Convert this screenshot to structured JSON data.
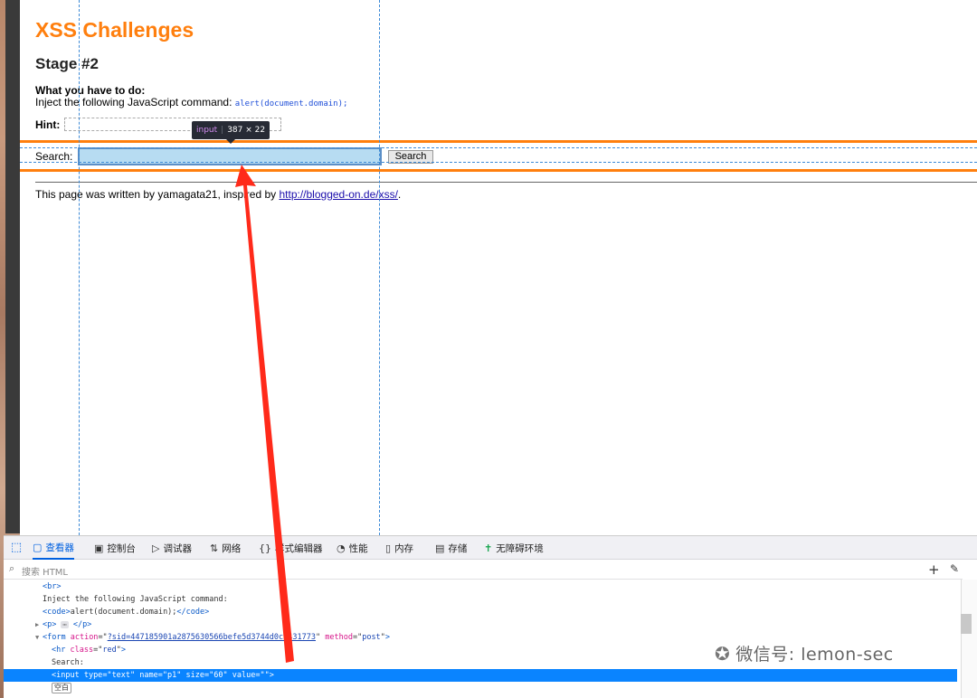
{
  "page": {
    "title": "XSS Challenges",
    "stage": "Stage #2",
    "what_label": "What you have to do:",
    "inject_text": "Inject the following JavaScript command:",
    "inject_code": "alert(document.domain);",
    "hint_label": "Hint:",
    "search_label": "Search:",
    "search_value": "",
    "search_button": "Search",
    "footer_text": "This page was written by yamagata21, inspired by",
    "footer_link": "http://blogged-on.de/xss/",
    "footer_end": "."
  },
  "tooltip": {
    "tag": "input",
    "size": "387 × 22"
  },
  "devtools": {
    "tabs": [
      {
        "label": "查看器",
        "icon": "inspector-icon",
        "active": true
      },
      {
        "label": "控制台",
        "icon": "console-icon",
        "active": false
      },
      {
        "label": "调试器",
        "icon": "debugger-icon",
        "active": false
      },
      {
        "label": "网络",
        "icon": "network-icon",
        "active": false
      },
      {
        "label": "样式编辑器",
        "icon": "style-editor-icon",
        "active": false
      },
      {
        "label": "性能",
        "icon": "performance-icon",
        "active": false
      },
      {
        "label": "内存",
        "icon": "memory-icon",
        "active": false
      },
      {
        "label": "存储",
        "icon": "storage-icon",
        "active": false
      },
      {
        "label": "无障碍环境",
        "icon": "accessibility-icon",
        "active": false
      }
    ],
    "search_placeholder": "搜索 HTML",
    "code": {
      "l1": "<br>",
      "l2": "Inject the following JavaScript command:",
      "l3_open": "<code>",
      "l3_text": "alert(document.domain);",
      "l3_close": "</code>",
      "l4_open": "<p>",
      "l4_close": "</p>",
      "form_action": "?sid=447185901a2875630566befe5d3744d0cd431773",
      "form_method": "post",
      "hr_class": "red",
      "search_text": "Search:",
      "input_type": "text",
      "input_name": "p1",
      "input_size": "60",
      "input_value": "",
      "blank_badge": "空白"
    }
  },
  "watermark": "微信号: lemon-sec"
}
